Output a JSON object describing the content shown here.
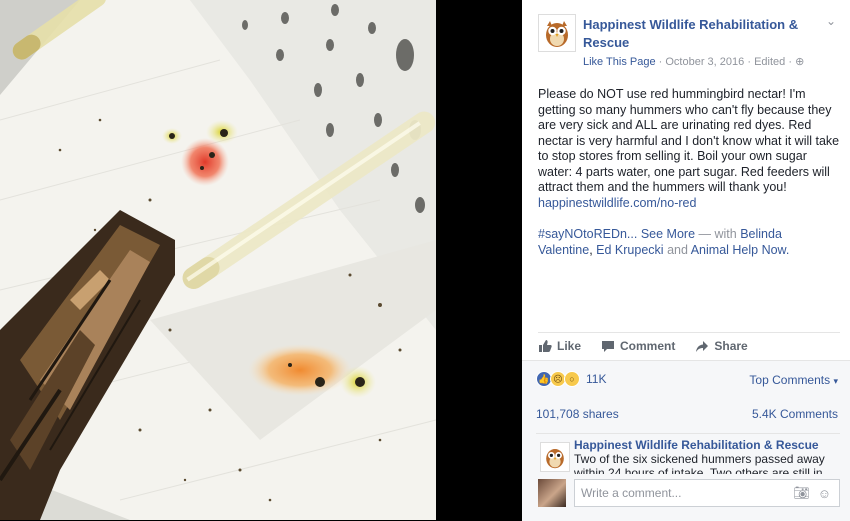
{
  "photo": {
    "alt_icon": "photo-hummingbird-feeding-area"
  },
  "post": {
    "page_name": "Happinest Wildlife Rehabilitation & Rescue",
    "like_page": "Like This Page",
    "date": "October 3, 2016",
    "edited": "Edited",
    "separator": "·",
    "body": "Please do NOT use red hummingbird nectar! I'm getting so many hummers who can't fly because they are very sick and ALL are urinating red dyes. Red nectar is very harmful and I don't know what it will take to stop stores from selling it. Boil your own sugar water: 4 parts water, one part sugar. Red feeders will attract them and the hummers will thank you!",
    "link": "happinestwildlife.com/no-red",
    "hashtag": "#sayNOtoREDn...",
    "see_more": "See More",
    "with_prefix": "— with",
    "tag1": "Belinda Valentine",
    "tag2": "Ed Krupecki",
    "and": "and",
    "tag3": "Animal Help Now."
  },
  "actions": {
    "like": "Like",
    "comment": "Comment",
    "share": "Share"
  },
  "feedback": {
    "reaction_count": "11K",
    "top_comments": "Top Comments",
    "top_comments_caret": "▾",
    "shares": "101,708 shares",
    "comments": "5.4K Comments"
  },
  "comment": {
    "author": "Happinest Wildlife Rehabilitation & Rescue",
    "text": "Two of the six sickened hummers passed away within 24 hours of intake. Two others are still in rough shape."
  },
  "composer": {
    "placeholder": "Write a comment..."
  },
  "colors": {
    "link": "#365899",
    "text": "#1d2129",
    "muted": "#90949c"
  }
}
